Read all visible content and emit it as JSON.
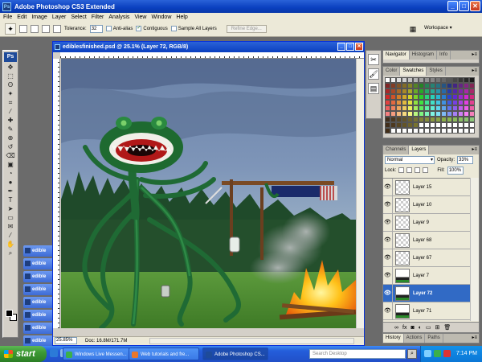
{
  "app": {
    "title": "Adobe Photoshop CS3 Extended",
    "window_buttons": [
      "_",
      "□",
      "✕"
    ]
  },
  "menu": [
    "File",
    "Edit",
    "Image",
    "Layer",
    "Select",
    "Filter",
    "Analysis",
    "View",
    "Window",
    "Help"
  ],
  "options": {
    "tolerance_label": "Tolerance:",
    "tolerance_value": "32",
    "anti_alias": "Anti-alias",
    "anti_alias_checked": false,
    "contiguous": "Contiguous",
    "contiguous_checked": true,
    "sample_all": "Sample All Layers",
    "sample_all_checked": false,
    "refine": "Refine Edge...",
    "workspace": "Workspace ▾"
  },
  "toolbox": {
    "logo": "Ps",
    "tools": [
      "move-tool-icon",
      "marquee-tool-icon",
      "lasso-tool-icon",
      "magic-wand-tool-icon",
      "crop-tool-icon",
      "eyedropper-tool-icon",
      "healing-brush-tool-icon",
      "brush-tool-icon",
      "clone-stamp-tool-icon",
      "history-brush-tool-icon",
      "eraser-tool-icon",
      "gradient-tool-icon",
      "blur-tool-icon",
      "dodge-tool-icon",
      "pen-tool-icon",
      "type-tool-icon",
      "path-selection-tool-icon",
      "shape-tool-icon",
      "notes-tool-icon",
      "eyedropper2-tool-icon",
      "hand-tool-icon",
      "zoom-tool-icon"
    ],
    "glyphs": [
      "✥",
      "⬚",
      "ʘ",
      "✦",
      "⌗",
      "⁄",
      "✚",
      "✎",
      "⊕",
      "↺",
      "⌫",
      "▣",
      "◔",
      "●",
      "✒",
      "T",
      "➤",
      "▭",
      "✉",
      "⁄",
      "✋",
      "⌕"
    ],
    "foreground_color": "#000000",
    "background_color": "#ffffff"
  },
  "minimized_docs": [
    "edible",
    "edible",
    "edible",
    "edible",
    "edible",
    "edible",
    "edible",
    "edible"
  ],
  "document": {
    "title": "ediblesfinished.psd @ 25.1% (Layer 72, RGB/8)",
    "zoom": "25.85%",
    "doc_info": "Doc: 16.8M/171.7M"
  },
  "panels": {
    "navigator_tabs": [
      "Navigator",
      "Histogram",
      "Info"
    ],
    "swatch_tabs": [
      "Color",
      "Swatches",
      "Styles"
    ],
    "layers_tabs": [
      "Channels",
      "Layers"
    ],
    "blend_mode": "Normal",
    "opacity_label": "Opacity:",
    "opacity": "33%",
    "lock_label": "Lock:",
    "fill_label": "Fill:",
    "fill": "100%",
    "layers": [
      {
        "name": "Layer 15",
        "selected": false
      },
      {
        "name": "Layer 10",
        "selected": false
      },
      {
        "name": "Layer 9",
        "selected": false
      },
      {
        "name": "Layer 68",
        "selected": false
      },
      {
        "name": "Layer 67",
        "selected": false
      },
      {
        "name": "Layer 7",
        "selected": false
      },
      {
        "name": "Layer 72",
        "selected": true
      },
      {
        "name": "Layer 71",
        "selected": false
      }
    ],
    "history_tabs": [
      "History",
      "Actions",
      "Paths"
    ]
  },
  "taskbar": {
    "start": "start",
    "buttons": [
      {
        "label": "Windows Live Messen...",
        "color": "#3bb04a"
      },
      {
        "label": "Web tutorials and fre...",
        "color": "#e8772c"
      },
      {
        "label": "Adobe Photoshop CS...",
        "color": "#1e4b9a"
      }
    ],
    "search_placeholder": "Search Desktop",
    "clock": "7:14 PM"
  }
}
